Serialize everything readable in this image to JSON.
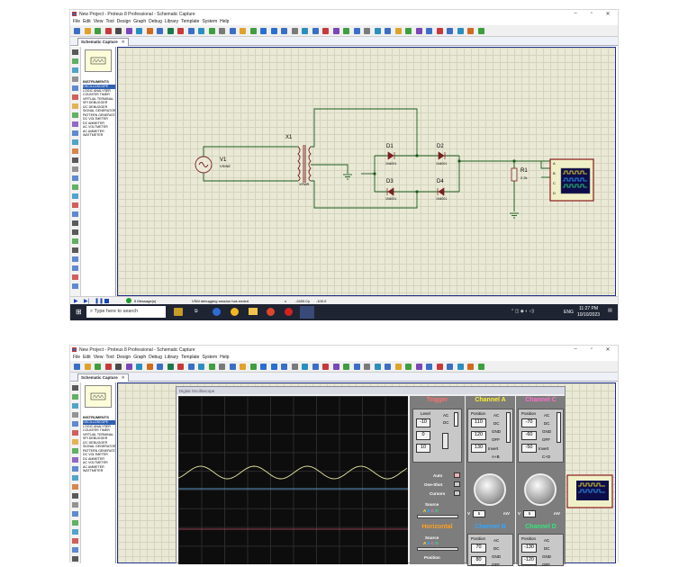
{
  "window": {
    "title": "New Project - Proteus 8 Professional - Schematic Capture",
    "controls": [
      "–",
      "▫",
      "✕"
    ]
  },
  "menu": [
    "File",
    "Edit",
    "View",
    "Tool",
    "Design",
    "Graph",
    "Debug",
    "Library",
    "Template",
    "System",
    "Help"
  ],
  "tab": {
    "label": "Schematic Capture",
    "close": "✕"
  },
  "panel": {
    "label": "INSTRUMENTS",
    "devices": [
      "OSCILLOSCOPE",
      "LOGIC ANALYSER",
      "COUNTER TIMER",
      "VIRTUAL TERMINAL",
      "SPI DEBUGGER",
      "I2C DEBUGGER",
      "SIGNAL GENERATOR",
      "PATTERN GENERATOR",
      "DC VOLTMETER",
      "DC AMMETER",
      "AC VOLTMETER",
      "AC AMMETER",
      "WATTMETER"
    ],
    "selected": "OSCILLOSCOPE"
  },
  "schematic": {
    "source_ref": "V1",
    "source_val": "VSINE",
    "xfmr_ref": "X1",
    "xfmr_val": "XFMR",
    "d1_ref": "D1",
    "d1_val": "1N4001",
    "d2_ref": "D2",
    "d2_val": "1N4001",
    "d3_ref": "D3",
    "d3_val": "1N4001",
    "d4_ref": "D4",
    "d4_val": "1N4001",
    "r1_ref": "R1",
    "r1_val": "2.2k",
    "scope_pins": [
      "A",
      "B",
      "C",
      "D"
    ]
  },
  "status": {
    "messages": "5 Message(s)",
    "info": "VSM debugging session has ended",
    "coord_x": "-2400.0",
    "coord_y": "-100.0"
  },
  "taskbar": {
    "search_placeholder": "Type here to search",
    "lang": "ENG",
    "time": "11:27 PM",
    "date": "10/10/2023"
  },
  "scope": {
    "title": "Digital Oscilloscope",
    "trigger": {
      "header": "Trigger",
      "level_label": "Level",
      "level_values": [
        "-10",
        "0",
        "10"
      ],
      "ac": "AC",
      "dc": "DC",
      "auto": "Auto",
      "one_shot": "One-Shot",
      "cursors": "Cursors",
      "source": "Source",
      "source_opts": [
        "A",
        "B",
        "C",
        "D"
      ]
    },
    "channel_a": {
      "header": "Channel A",
      "position": "Position",
      "values": [
        "110",
        "120",
        "130"
      ],
      "coupling": [
        "AC",
        "DC",
        "GND",
        "OFF"
      ],
      "invert": "Invert",
      "sum": "A+B",
      "scale": "5",
      "unit_v": "V",
      "unit_mv": "mV"
    },
    "channel_c": {
      "header": "Channel C",
      "position": "Position",
      "values": [
        "-70",
        "-60",
        "-50"
      ],
      "coupling": [
        "AC",
        "DC",
        "GND",
        "OFF"
      ],
      "invert": "Invert",
      "sum": "C+D",
      "scale": "5",
      "unit_v": "V",
      "unit_mv": "mV"
    },
    "horizontal": {
      "header": "Horizontal",
      "source": "Source",
      "source_opts": [
        "A",
        "B",
        "C",
        "D"
      ],
      "position": "Position"
    },
    "channel_b": {
      "header": "Channel B",
      "position": "Position",
      "values": [
        "70",
        "80"
      ],
      "coupling": [
        "AC",
        "DC",
        "GND",
        "OFF"
      ]
    },
    "channel_d": {
      "header": "Channel D",
      "position": "Position",
      "values": [
        "-130",
        "-120"
      ],
      "coupling": [
        "AC",
        "DC",
        "GND",
        "OFF"
      ]
    }
  },
  "colors": {
    "trace_a": "#e6e6a0",
    "trace_c": "#6ec0ff",
    "trace_b": "#c0506a",
    "trigger": "#ff7070",
    "ch_a": "#ffee33",
    "ch_b": "#33a6ff",
    "ch_c": "#ff6fd0",
    "ch_d": "#33e57a",
    "horizontal": "#ffa020"
  }
}
